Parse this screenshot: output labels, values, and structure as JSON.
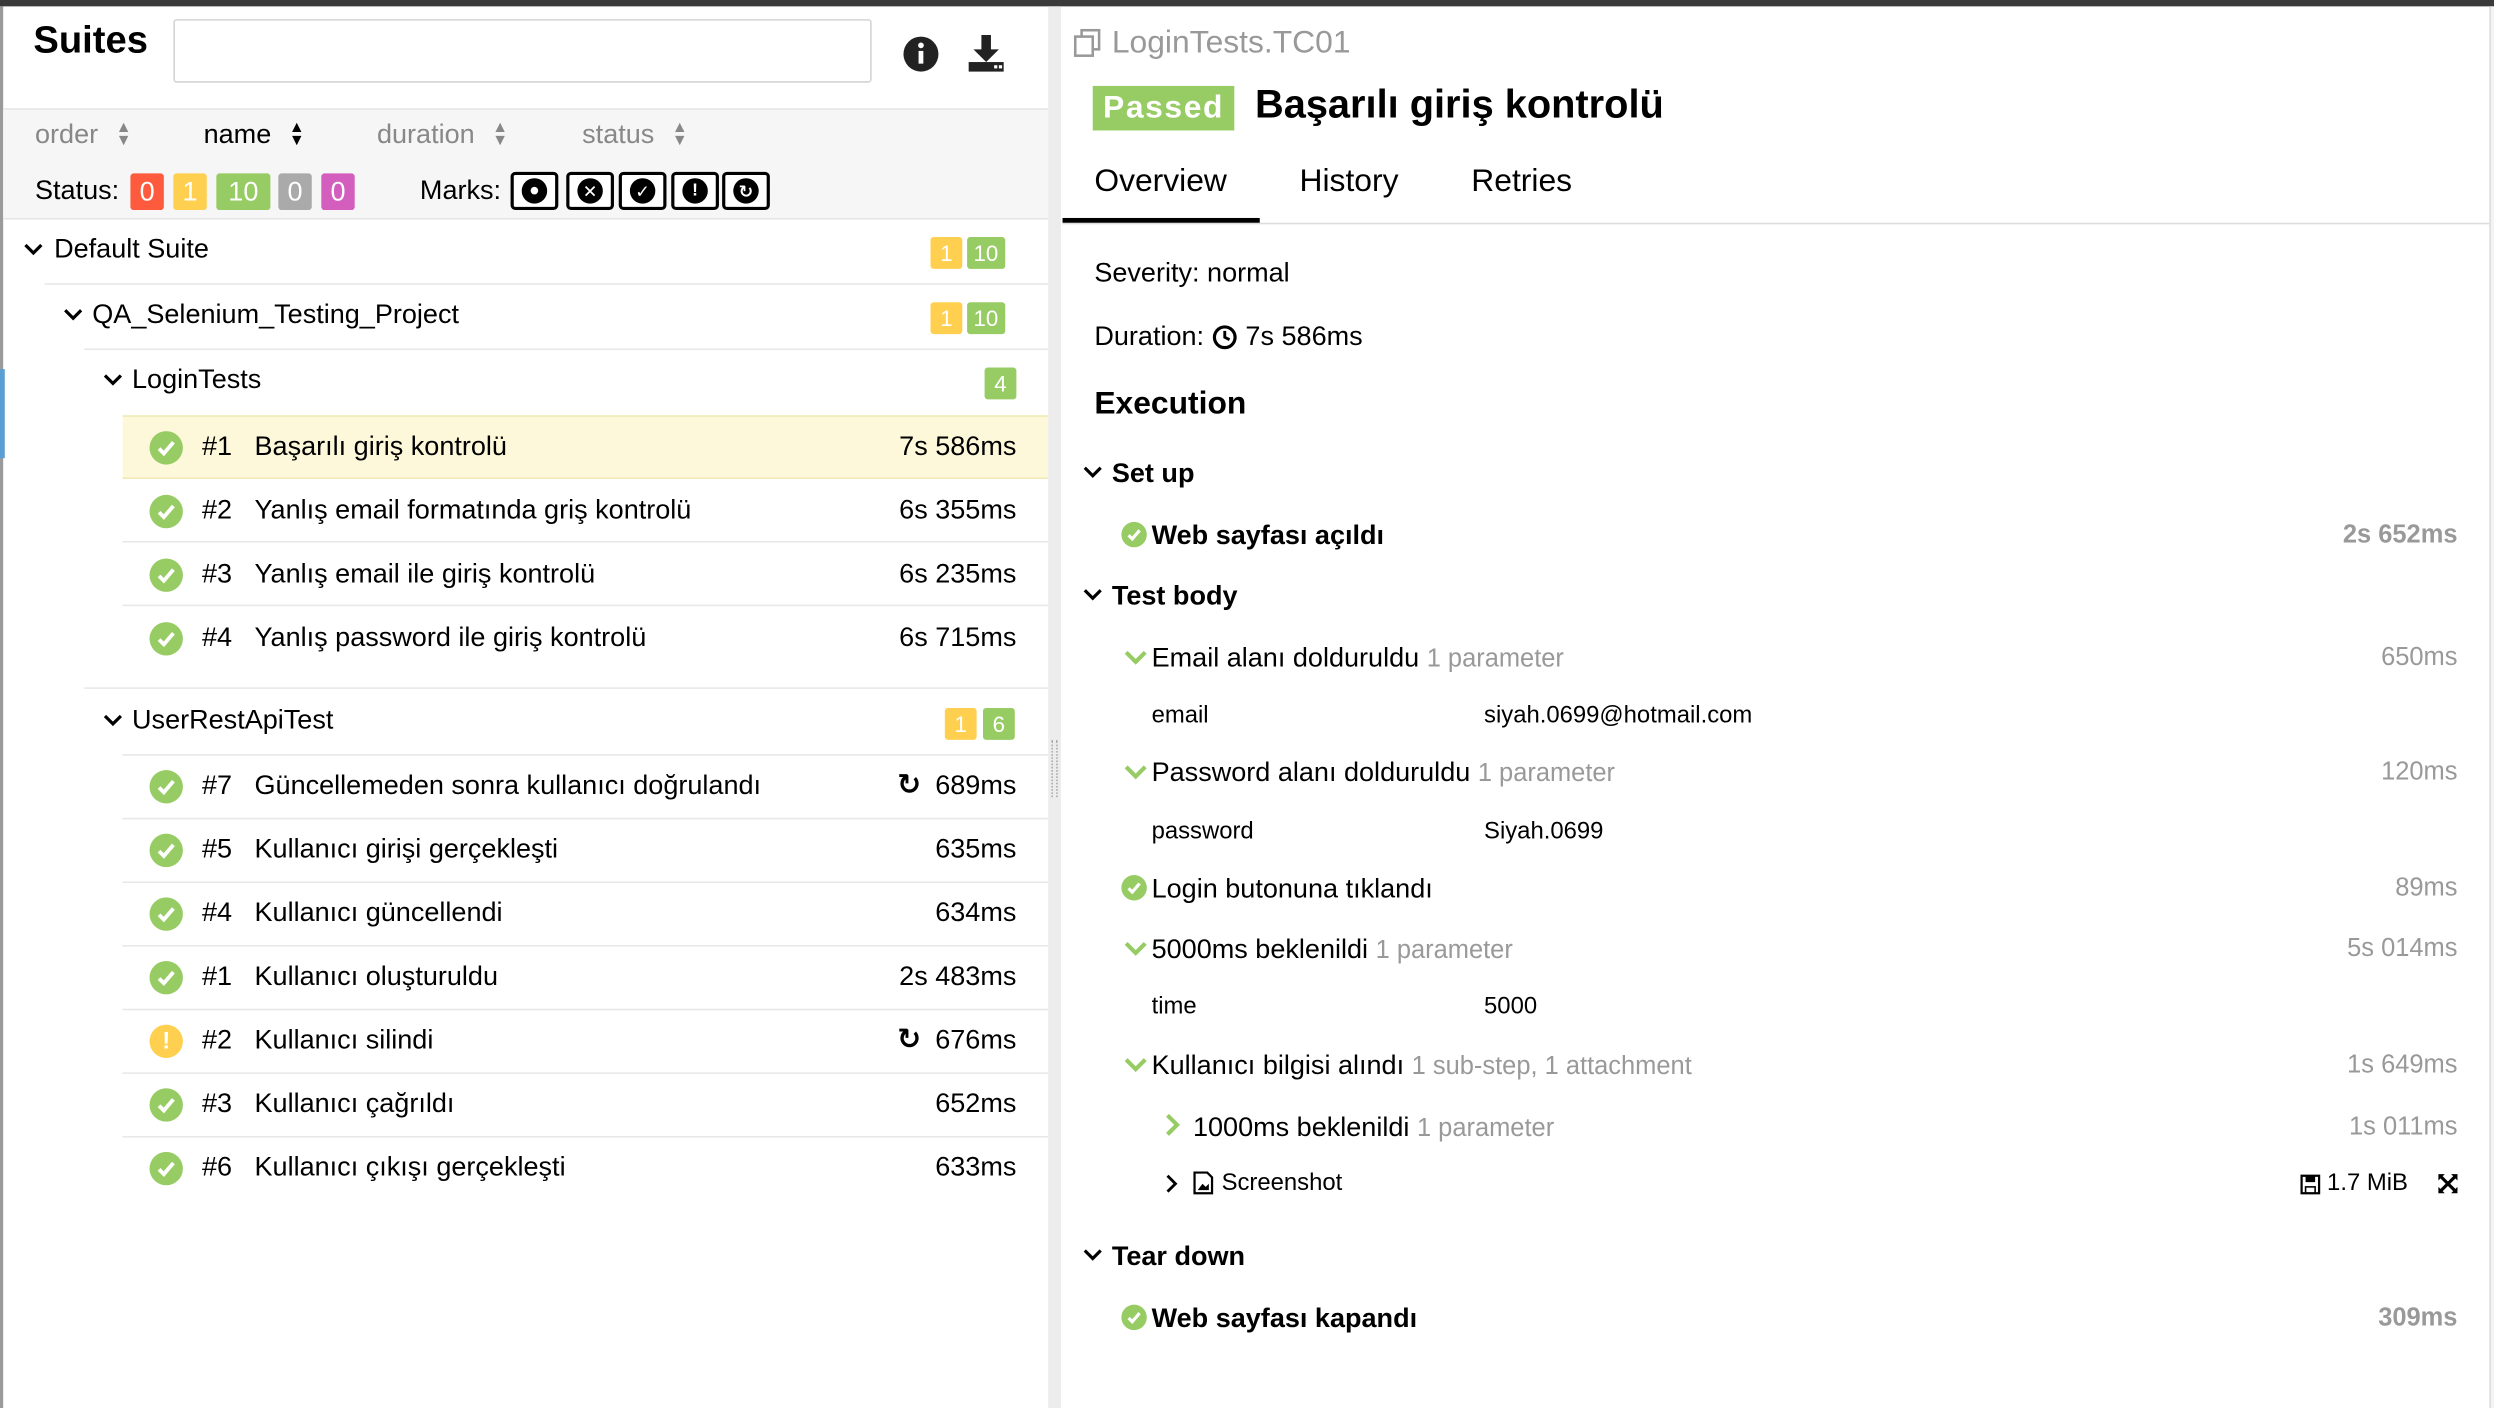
{
  "suites_panel": {
    "title": "Suites",
    "search_value": "",
    "sorters": [
      {
        "label": "order",
        "active": false
      },
      {
        "label": "name",
        "active": true
      },
      {
        "label": "duration",
        "active": false
      },
      {
        "label": "status",
        "active": false
      }
    ],
    "status_label": "Status:",
    "status_counts": [
      {
        "value": "0",
        "status": "failed",
        "color": "#fd5a3e"
      },
      {
        "value": "1",
        "status": "broken",
        "color": "#ffd050"
      },
      {
        "value": "10",
        "status": "passed",
        "color": "#97cc64"
      },
      {
        "value": "0",
        "status": "skipped",
        "color": "#aaaaaa"
      },
      {
        "value": "0",
        "status": "unknown",
        "color": "#d35ebe"
      }
    ],
    "marks_label": "Marks:",
    "marks_icons": [
      "bomb-icon",
      "times-circle-icon",
      "check-circle-icon",
      "exclamation-circle-icon",
      "refresh-icon"
    ],
    "tree": {
      "default_suite": {
        "name": "Default Suite",
        "broken": "1",
        "passed": "10"
      },
      "project": {
        "name": "QA_Selenium_Testing_Project",
        "broken": "1",
        "passed": "10"
      },
      "login_tests": {
        "name": "LoginTests",
        "passed": "4",
        "items": [
          {
            "num": "#1",
            "name": "Başarılı giriş kontrolü",
            "duration": "7s 586ms",
            "status": "passed"
          },
          {
            "num": "#2",
            "name": "Yanlış email formatında griş kontrolü",
            "duration": "6s 355ms",
            "status": "passed"
          },
          {
            "num": "#3",
            "name": "Yanlış email ile giriş kontrolü",
            "duration": "6s 235ms",
            "status": "passed"
          },
          {
            "num": "#4",
            "name": "Yanlış password ile giriş kontrolü",
            "duration": "6s 715ms",
            "status": "passed"
          }
        ]
      },
      "user_rest_api": {
        "name": "UserRestApiTest",
        "broken": "1",
        "passed": "6",
        "items": [
          {
            "num": "#7",
            "name": "Güncellemeden sonra kullanıcı doğrulandı",
            "duration": "689ms",
            "status": "passed",
            "retries": true
          },
          {
            "num": "#5",
            "name": "Kullanıcı girişi gerçekleşti",
            "duration": "635ms",
            "status": "passed"
          },
          {
            "num": "#4",
            "name": "Kullanıcı güncellendi",
            "duration": "634ms",
            "status": "passed"
          },
          {
            "num": "#1",
            "name": "Kullanıcı oluşturuldu",
            "duration": "2s 483ms",
            "status": "passed"
          },
          {
            "num": "#2",
            "name": "Kullanıcı silindi",
            "duration": "676ms",
            "status": "broken",
            "retries": true
          },
          {
            "num": "#3",
            "name": "Kullanıcı çağrıldı",
            "duration": "652ms",
            "status": "passed"
          },
          {
            "num": "#6",
            "name": "Kullanıcı çıkışı gerçekleşti",
            "duration": "633ms",
            "status": "passed"
          }
        ]
      }
    }
  },
  "details": {
    "path": "LoginTests.TC01",
    "status_badge": "Passed",
    "test_name": "Başarılı giriş kontrolü",
    "tabs": [
      "Overview",
      "History",
      "Retries"
    ],
    "active_tab": "Overview",
    "severity": "Severity: normal",
    "duration_label": "Duration:",
    "duration_value": "7s 586ms",
    "execution_title": "Execution",
    "setup": {
      "title": "Set up",
      "steps": [
        {
          "name": "Web sayfası açıldı",
          "time": "2s 652ms"
        }
      ]
    },
    "test_body": {
      "title": "Test body",
      "steps": [
        {
          "name": "Email alanı dolduruldu",
          "meta": "1 parameter",
          "time": "650ms",
          "param_name": "email",
          "param_value": "siyah.0699@hotmail.com"
        },
        {
          "name": "Password alanı dolduruldu",
          "meta": "1 parameter",
          "time": "120ms",
          "param_name": "password",
          "param_value": "Siyah.0699"
        },
        {
          "name": "Login butonuna tıklandı",
          "meta": "",
          "time": "89ms"
        },
        {
          "name": "5000ms beklenildi",
          "meta": "1 parameter",
          "time": "5s 014ms",
          "param_name": "time",
          "param_value": "5000"
        },
        {
          "name": "Kullanıcı bilgisi alındı",
          "meta": "1 sub-step, 1 attachment",
          "time": "1s 649ms"
        },
        {
          "name": "1000ms beklenildi",
          "meta": "1 parameter",
          "time": "1s 011ms"
        }
      ],
      "attachment": {
        "name": "Screenshot",
        "size": "1.7 MiB"
      }
    },
    "teardown": {
      "title": "Tear down",
      "steps": [
        {
          "name": "Web sayfası kapandı",
          "time": "309ms"
        }
      ]
    }
  }
}
